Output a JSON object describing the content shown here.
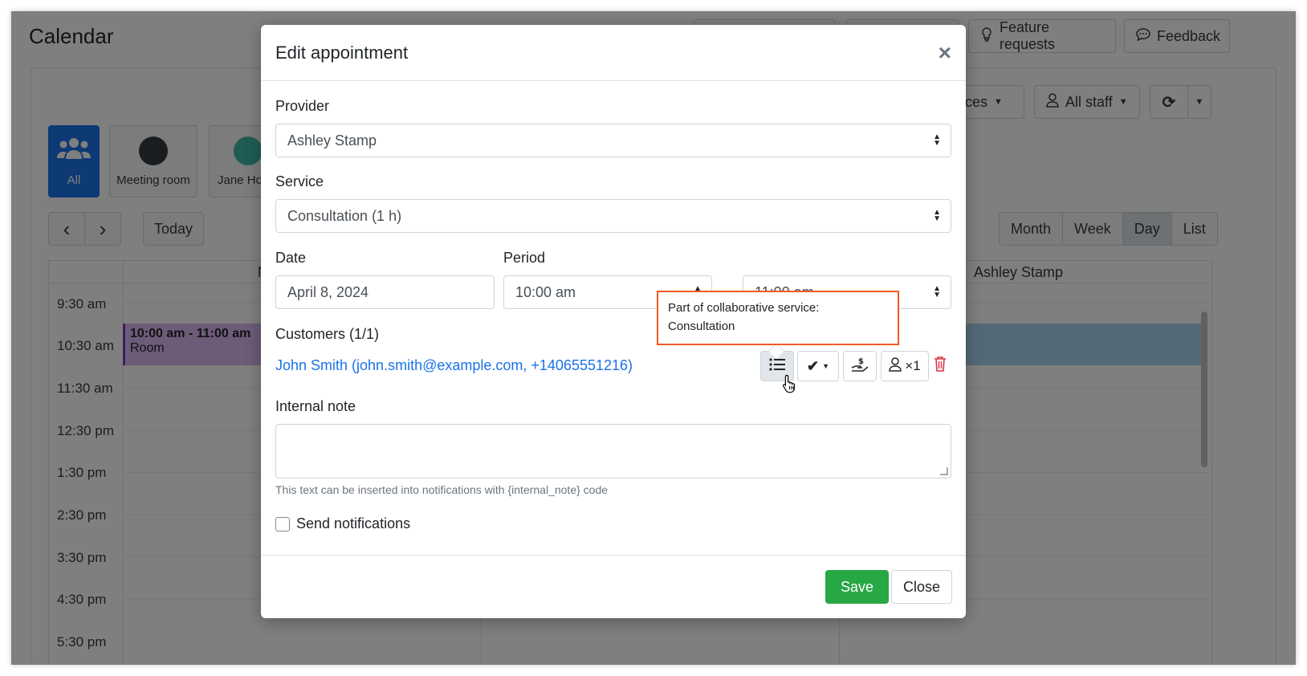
{
  "page": {
    "title": "Calendar",
    "top_buttons": [
      "Feature requests",
      "Feedback"
    ],
    "filters": {
      "services_label": "vices",
      "staff_label": "All staff"
    },
    "staff": [
      {
        "name": "All"
      },
      {
        "name": "Meeting room"
      },
      {
        "name": "Jane Ho"
      }
    ],
    "nav": {
      "today": "Today",
      "prev": "‹",
      "next": "›"
    },
    "views": [
      "Month",
      "Week",
      "Day",
      "List"
    ],
    "active_view": "Day",
    "column_title": "Ashley Stamp",
    "column_title_partial": "N",
    "times": [
      "9:30 am",
      "10:30 am",
      "11:30 am",
      "12:30 pm",
      "1:30 pm",
      "2:30 pm",
      "3:30 pm",
      "4:30 pm",
      "5:30 pm"
    ],
    "event": {
      "time": "10:00 am - 11:00 am",
      "title": "Room"
    }
  },
  "modal": {
    "title": "Edit appointment",
    "close_symbol": "×",
    "provider_label": "Provider",
    "provider_value": "Ashley Stamp",
    "service_label": "Service",
    "service_value": "Consultation (1 h)",
    "date_label": "Date",
    "date_value": "April 8, 2024",
    "period_label": "Period",
    "period_start": "10:00 am",
    "period_end": "11:00 am",
    "period_dash": "-",
    "customers_label": "Customers (1/1)",
    "customer": "John Smith (john.smith@example.com, +14065551216)",
    "customer_count_badge": "×1",
    "internal_note_label": "Internal note",
    "internal_note_value": "",
    "internal_note_help": "This text can be inserted into notifications with {internal_note} code",
    "send_notifications_label": "Send notifications",
    "send_notifications_checked": false,
    "save_label": "Save",
    "close_label": "Close"
  },
  "tooltip": {
    "line1": "Part of collaborative service:",
    "line2": "Consultation"
  },
  "colors": {
    "primary": "#1a73e8",
    "success": "#28a745",
    "danger": "#dc3545",
    "highlight": "#f15a22",
    "event_purple": "#d8b8ee",
    "event_blue": "#a7d4ec"
  }
}
